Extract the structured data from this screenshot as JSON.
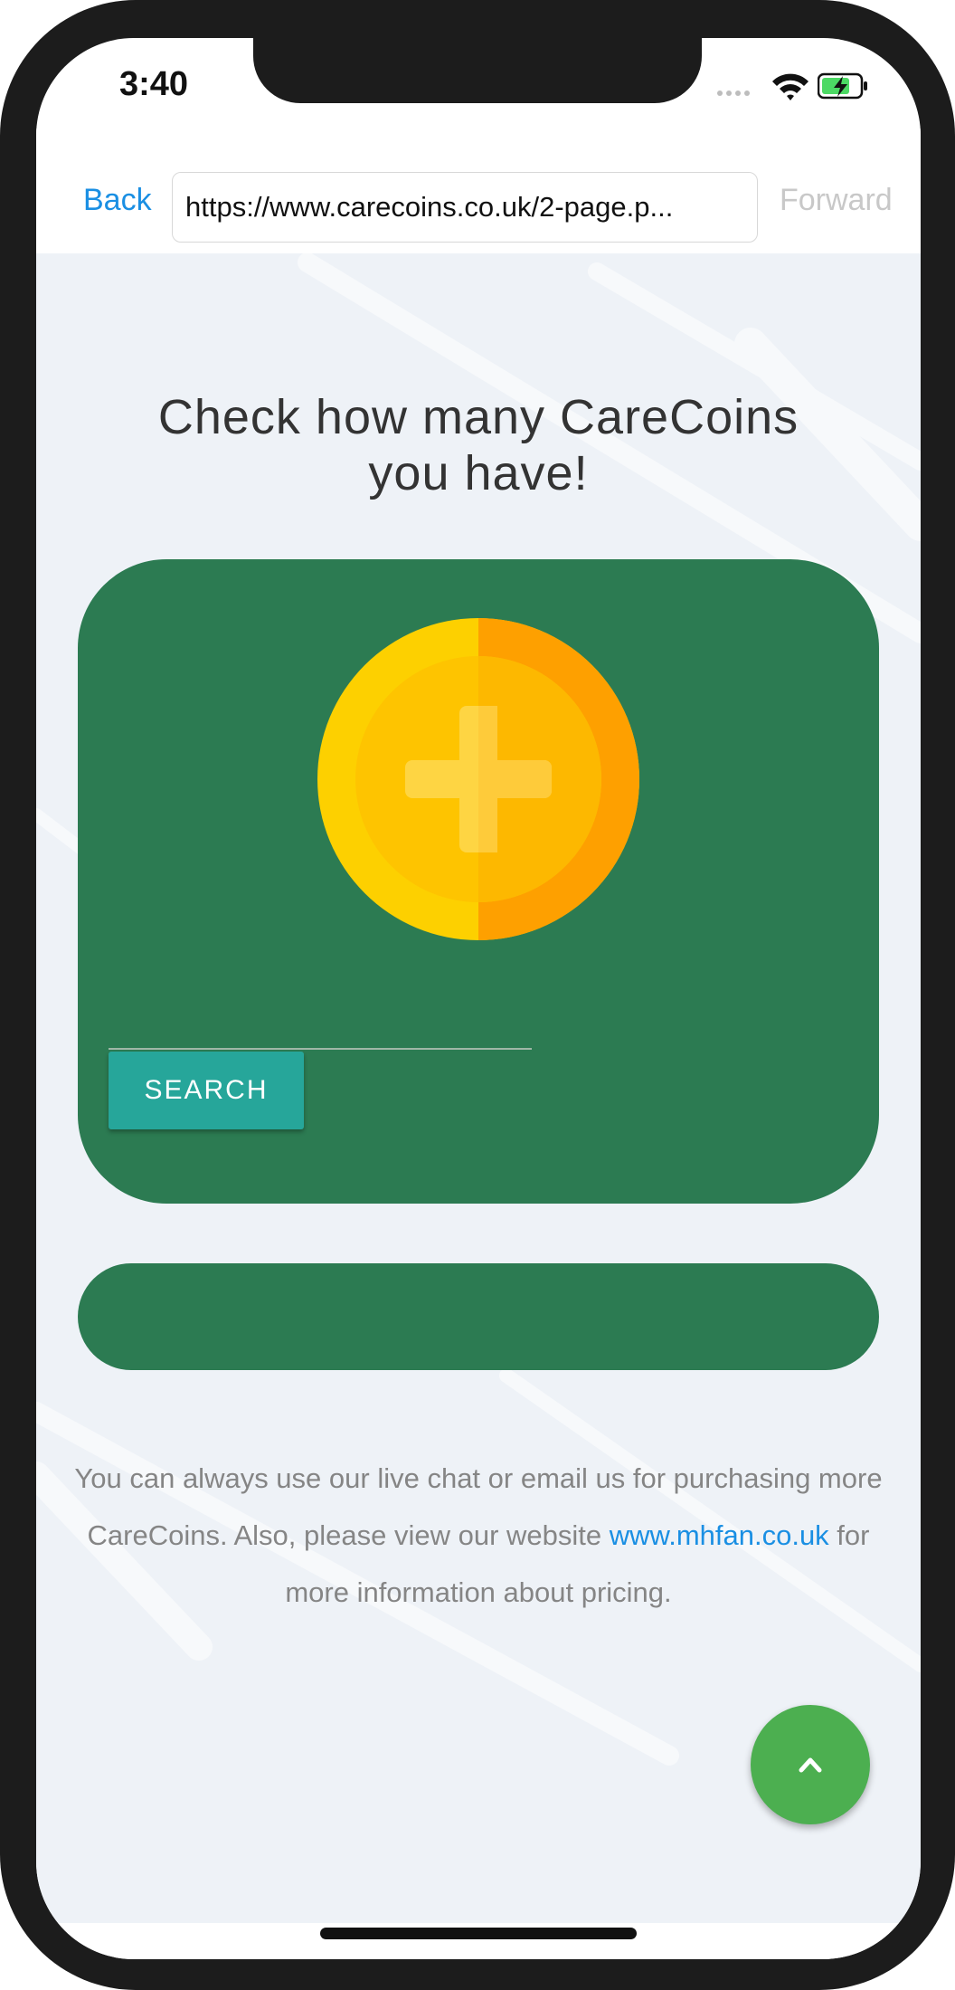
{
  "status_bar": {
    "time": "3:40",
    "wifi_icon": "wifi-icon",
    "battery_icon": "battery-charging-icon",
    "battery_color": "#4cd964"
  },
  "browser": {
    "back_label": "Back",
    "url": "https://www.carecoins.co.uk/2-page.p...",
    "forward_label": "Forward"
  },
  "page": {
    "title_line1": "Check how many CareCoins",
    "title_line2": "you have!",
    "coin_icon": "coin-plus-icon",
    "search_input_value": "",
    "search_button_label": "SEARCH",
    "info_text_part1": "You can always use our live chat or email us for purchasing more CareCoins. Also, please view our website ",
    "info_link": "www.mhfan.co.uk",
    "info_text_part2": " for more information about pricing.",
    "scroll_top_icon": "chevron-up-icon"
  },
  "colors": {
    "card_green": "#2c7b52",
    "button_teal": "#26a69a",
    "fab_green": "#4caf50",
    "link_blue": "#1a8fe3",
    "page_bg": "#eef2f7"
  }
}
